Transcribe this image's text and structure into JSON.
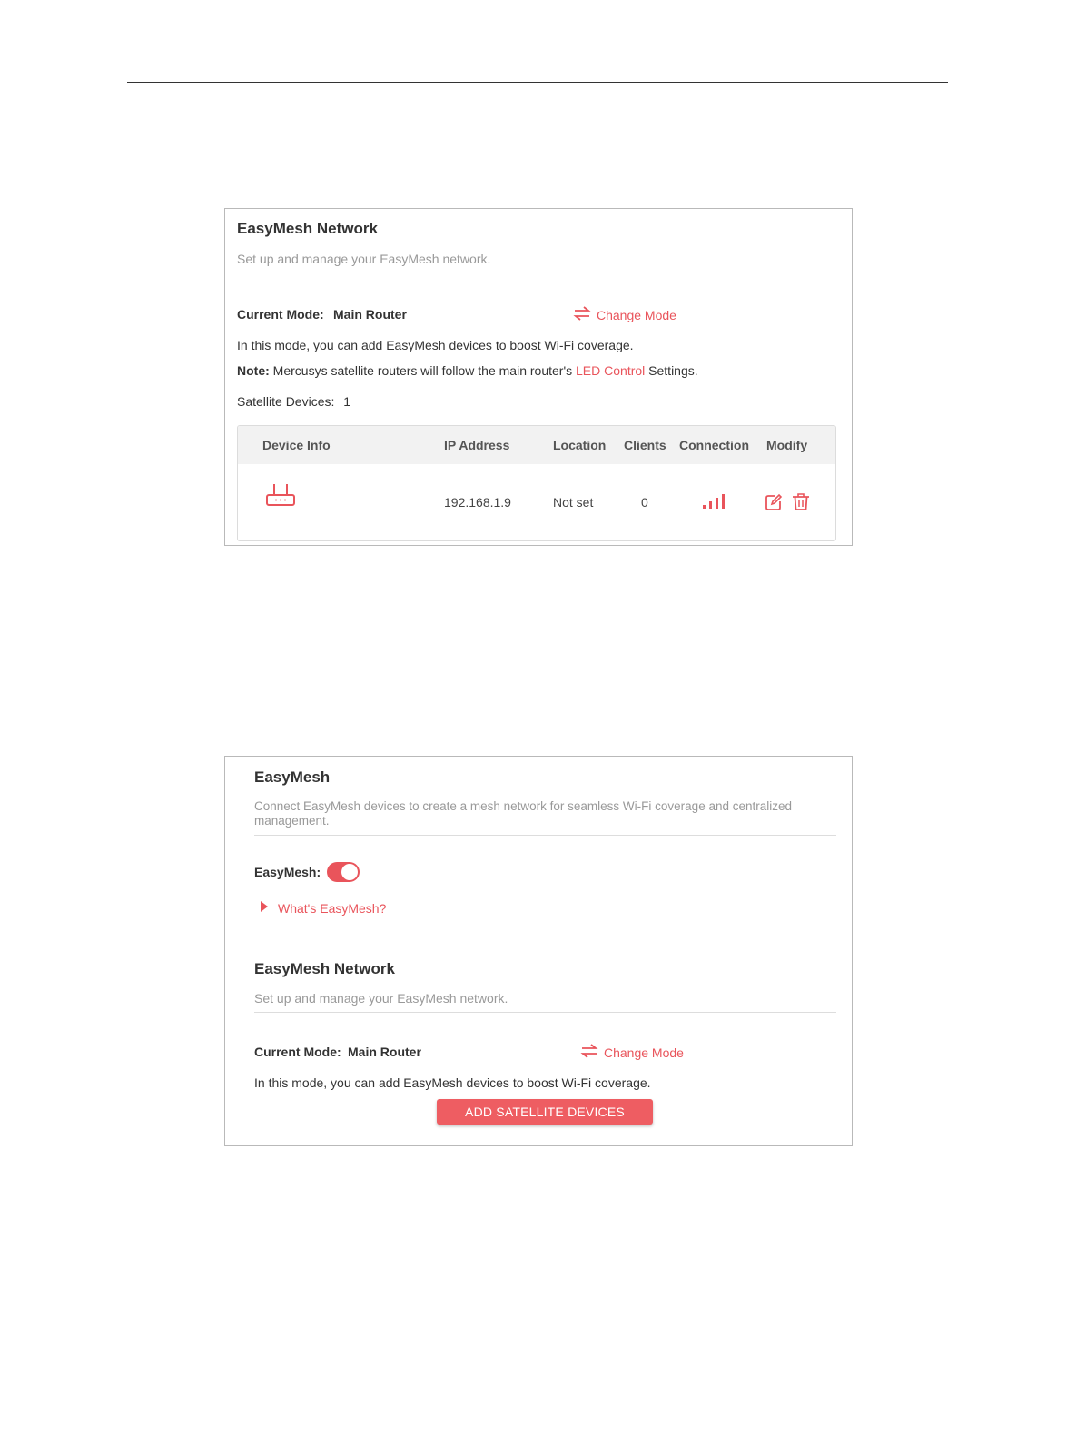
{
  "panel1": {
    "title": "EasyMesh Network",
    "description": "Set up and manage your EasyMesh network.",
    "current_mode_label": "Current Mode:",
    "current_mode_value": "Main Router",
    "change_mode_label": "Change Mode",
    "mode_info": "In this mode, you can add EasyMesh devices to boost Wi-Fi coverage.",
    "note_label": "Note:",
    "note_text_before": "Mercusys satellite routers will follow the main router's",
    "note_link": "LED Control",
    "note_text_after": "Settings.",
    "satellite_label": "Satellite Devices:",
    "satellite_count": "1",
    "table": {
      "headers": [
        "Device Info",
        "IP Address",
        "Location",
        "Clients",
        "Connection",
        "Modify"
      ],
      "rows": [
        {
          "device_icon": "router-icon",
          "ip": "192.168.1.9",
          "location": "Not set",
          "clients": "0",
          "connection_icon": "signal-bars-icon",
          "modify_icons": [
            "edit-icon",
            "delete-icon"
          ]
        }
      ]
    }
  },
  "panel2": {
    "title": "EasyMesh",
    "description_line1": "Connect EasyMesh devices to create a mesh network for seamless Wi-Fi coverage and centralized",
    "description_line2": "management.",
    "toggle_label": "EasyMesh:",
    "toggle_state": "on",
    "whats_label": "What's EasyMesh?",
    "network_title": "EasyMesh Network",
    "network_description": "Set up and manage your EasyMesh network.",
    "current_mode_label": "Current Mode:",
    "current_mode_value": "Main Router",
    "change_mode_label": "Change Mode",
    "mode_info": "In this mode, you can add EasyMesh devices to boost Wi-Fi coverage.",
    "add_button": "ADD SATELLITE DEVICES"
  },
  "colors": {
    "accent": "#e9545b",
    "button": "#ee5d62",
    "table_header_bg": "#f2f2f2"
  }
}
